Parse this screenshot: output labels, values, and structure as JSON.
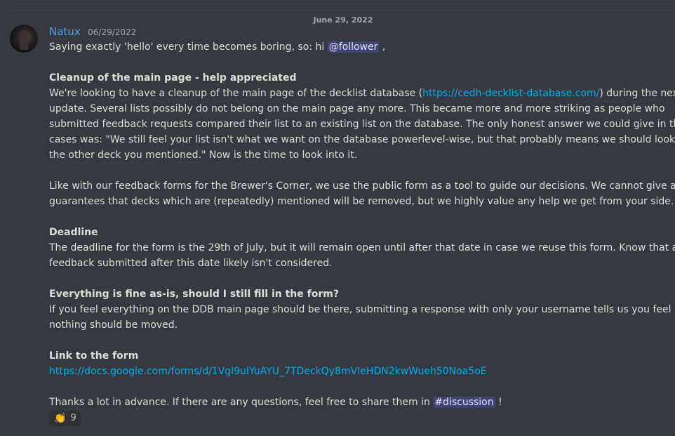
{
  "divider": {
    "date": "June 29, 2022"
  },
  "message": {
    "author": "Natux",
    "timestamp": "06/29/2022",
    "intro_text": "Saying exactly 'hello' every time becomes boring, so: hi ",
    "mention": "@follower",
    "intro_end": " ,",
    "section1": {
      "heading": "Cleanup of the main page - help appreciated",
      "line1_a": "We're looking to have a cleanup of the main page of the decklist database (",
      "line1_link": "https://cedh-decklist-database.com/",
      "line1_b": ") during the next",
      "line2": "update. Several lists possibly do not belong on the main page any more. This became more and more striking as people who",
      "line3": "submitted feedback requests compared their list to an existing list on the database. The only honest answer we could give in those",
      "line4": "cases was: \"We still feel your list isn't what we want on the database powerlevel-wise, but that probably means we should look into",
      "line5": "the other deck you mentioned.\" Now is the time to look into it."
    },
    "paragraph2": {
      "line1": "Like with our feedback forms for the Brewer's Corner, we use the public form as a tool to guide our decisions. We cannot give any",
      "line2": "guarantees that decks which are (repeatedly) mentioned will be removed, but we highly value any help we get from your side."
    },
    "section2": {
      "heading": "Deadline",
      "line1": "The deadline for the form is the 29th of July, but it will remain open until after that date in case we reuse this form. Know that any",
      "line2": "feedback submitted after this date likely isn't considered."
    },
    "section3": {
      "heading": "Everything is fine as-is, should I still fill in the form?",
      "line1": "If you feel everything on the DDB main page should be there, submitting a response with only your username tells us you feel",
      "line2": "nothing should be moved."
    },
    "section4": {
      "heading": "Link to the form",
      "link": "https://docs.google.com/forms/d/1Vgl9uIYuAYU_7TDeckQy8mVIeHDN2kwWueh50Noa5oE"
    },
    "closing_text": "Thanks a lot in advance. If there are any questions, feel free to share them in ",
    "channel": "#discussion",
    "closing_end": " !"
  },
  "reaction": {
    "emoji": "👏",
    "count": "9",
    "icon": "clapping-hands-icon"
  }
}
